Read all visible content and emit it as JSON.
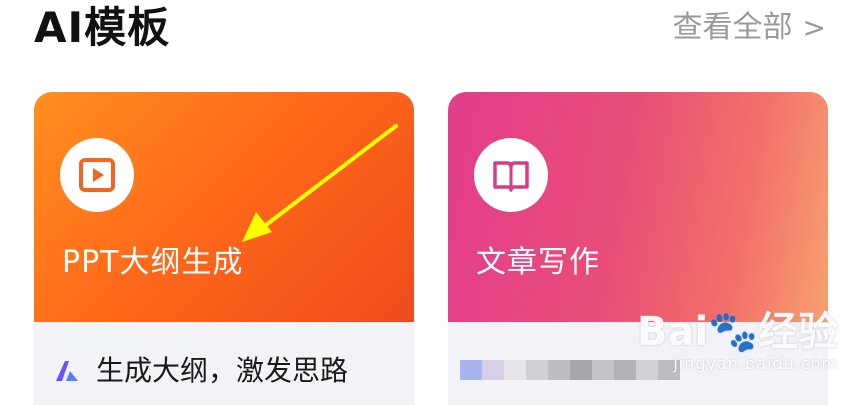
{
  "header": {
    "title": "AI模板",
    "view_all_label": "查看全部",
    "view_all_chevron": ">"
  },
  "cards": [
    {
      "label": "PPT大纲生成",
      "icon": "play-icon",
      "footer_text": "生成大纲，激发思路",
      "footer_icon": "app-logo-icon",
      "colors": {
        "start": "#ff8f1f",
        "end": "#f04a1c",
        "icon": "#f0651f"
      }
    },
    {
      "label": "文章写作",
      "icon": "book-icon",
      "colors": {
        "start": "#e23d8c",
        "end": "#f7a06e",
        "icon": "#d93c86"
      }
    }
  ],
  "annotation": {
    "arrow_color": "#ffff00"
  },
  "watermark": {
    "main": "Bai",
    "main_suffix": "经验",
    "sub": "jingyan.baidu.com"
  }
}
